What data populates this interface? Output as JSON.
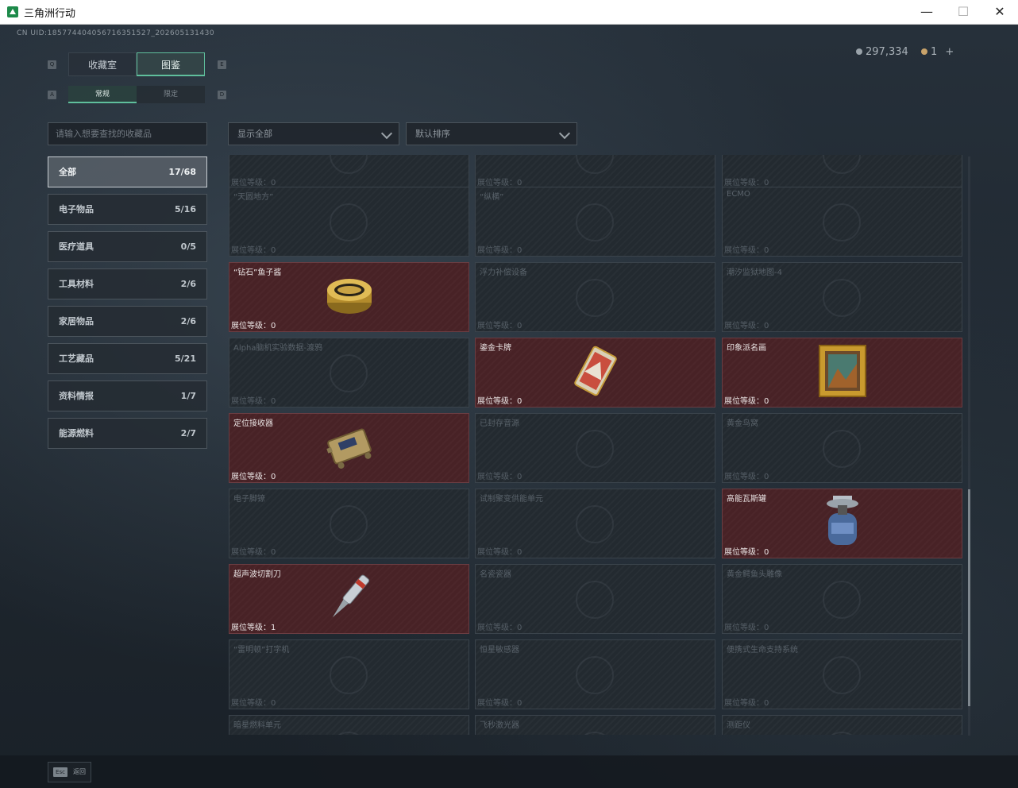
{
  "window": {
    "title": "三角洲行动",
    "minimize": "—",
    "maximize": "☐",
    "close": "✕"
  },
  "uid": "CN UID:185774404056716351527_202605131430",
  "currency": {
    "coins": "297,334",
    "tickets": "1",
    "add": "+"
  },
  "tabs": {
    "hint_left": "Q",
    "hint_right": "E",
    "items": [
      "收藏室",
      "图鉴"
    ],
    "active": "图鉴"
  },
  "subtabs": {
    "hint_left": "A",
    "hint_right": "D",
    "items": [
      "常规",
      "限定"
    ],
    "active": "常规"
  },
  "search": {
    "placeholder": "请输入想要查找的收藏品"
  },
  "filters": {
    "display": "显示全部",
    "sort": "默认排序"
  },
  "categories": [
    {
      "label": "全部",
      "count": "17/68"
    },
    {
      "label": "电子物品",
      "count": "5/16"
    },
    {
      "label": "医疗道具",
      "count": "0/5"
    },
    {
      "label": "工具材料",
      "count": "2/6"
    },
    {
      "label": "家居物品",
      "count": "2/6"
    },
    {
      "label": "工艺藏品",
      "count": "5/21"
    },
    {
      "label": "资料情报",
      "count": "1/7"
    },
    {
      "label": "能源燃料",
      "count": "2/7"
    }
  ],
  "grid": {
    "level_label": "展位等级：",
    "rows": [
      [
        {
          "name": "",
          "level": "0",
          "owned": false
        },
        {
          "name": "",
          "level": "0",
          "owned": false
        },
        {
          "name": "",
          "level": "0",
          "owned": false
        }
      ],
      [
        {
          "name": "“天圆地方”",
          "level": "0",
          "owned": false
        },
        {
          "name": "“纵横”",
          "level": "0",
          "owned": false
        },
        {
          "name": "ECMO",
          "level": "0",
          "owned": false
        }
      ],
      [
        {
          "name": "“钻石”鱼子酱",
          "level": "0",
          "owned": true,
          "icon": "caviar-tin-icon"
        },
        {
          "name": "浮力补偿设备",
          "level": "0",
          "owned": false
        },
        {
          "name": "潮汐监狱地图-4",
          "level": "0",
          "owned": false
        }
      ],
      [
        {
          "name": "Alpha脑机实验数据-渡鸦",
          "level": "0",
          "owned": false
        },
        {
          "name": "鎏金卡牌",
          "level": "0",
          "owned": true,
          "icon": "gilded-card-icon"
        },
        {
          "name": "印象派名画",
          "level": "0",
          "owned": true,
          "icon": "framed-painting-icon"
        }
      ],
      [
        {
          "name": "定位接收器",
          "level": "0",
          "owned": true,
          "icon": "locator-receiver-icon"
        },
        {
          "name": "已封存音源",
          "level": "0",
          "owned": false
        },
        {
          "name": "黄金鸟窝",
          "level": "0",
          "owned": false
        }
      ],
      [
        {
          "name": "电子脚镣",
          "level": "0",
          "owned": false
        },
        {
          "name": "试制聚变供能单元",
          "level": "0",
          "owned": false
        },
        {
          "name": "高能瓦斯罐",
          "level": "0",
          "owned": true,
          "icon": "gas-canister-icon"
        }
      ],
      [
        {
          "name": "超声波切割刀",
          "level": "1",
          "owned": true,
          "icon": "ultrasonic-cutter-icon"
        },
        {
          "name": "名瓷瓷器",
          "level": "0",
          "owned": false
        },
        {
          "name": "黄金鳄鱼头雕像",
          "level": "0",
          "owned": false
        }
      ],
      [
        {
          "name": "“雷明顿”打字机",
          "level": "0",
          "owned": false
        },
        {
          "name": "恒星敏感器",
          "level": "0",
          "owned": false
        },
        {
          "name": "便携式生命支持系统",
          "level": "0",
          "owned": false
        }
      ],
      [
        {
          "name": "暗星燃料单元",
          "level": "",
          "owned": false
        },
        {
          "name": "飞秒激光器",
          "level": "",
          "owned": false
        },
        {
          "name": "测距仪",
          "level": "",
          "owned": false
        }
      ]
    ]
  },
  "footer": {
    "esc_key": "Esc",
    "esc_label": "返回"
  },
  "colors": {
    "accent": "#5fbf9c",
    "owned_card": "#482226",
    "card": "#232a30"
  }
}
